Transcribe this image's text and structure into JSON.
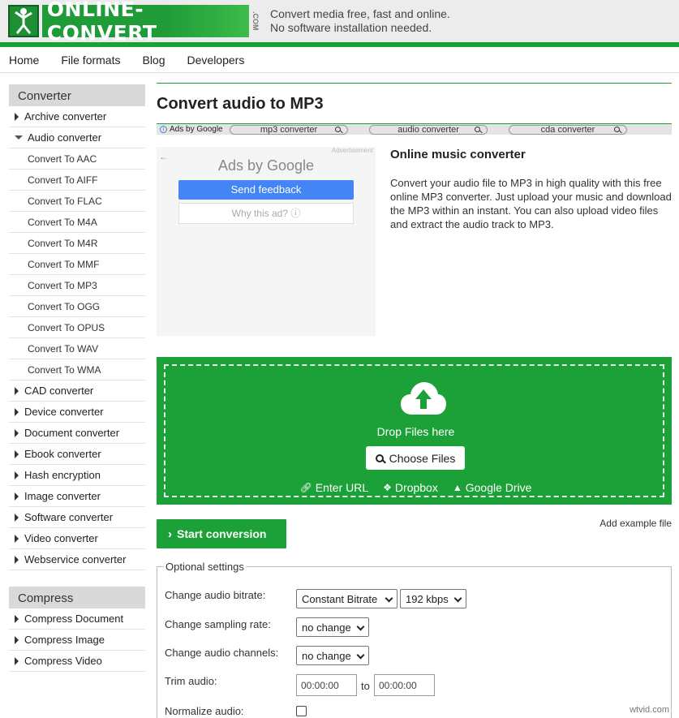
{
  "header": {
    "logo_text": "ONLINE-CONVERT",
    "logo_com": ".COM",
    "logo_icon": "figure-icon",
    "tagline_1": "Convert media free, fast and online.",
    "tagline_2": "No software installation needed.",
    "brand_color": "#1ba137"
  },
  "nav": {
    "items": [
      "Home",
      "File formats",
      "Blog",
      "Developers"
    ]
  },
  "sidebar": {
    "converter_head": "Converter",
    "converter_items": [
      "Archive converter",
      "Audio converter"
    ],
    "audio_sub": [
      "Convert To AAC",
      "Convert To AIFF",
      "Convert To FLAC",
      "Convert To M4A",
      "Convert To M4R",
      "Convert To MMF",
      "Convert To MP3",
      "Convert To OGG",
      "Convert To OPUS",
      "Convert To WAV",
      "Convert To WMA"
    ],
    "converter_items_after": [
      "CAD converter",
      "Device converter",
      "Document converter",
      "Ebook converter",
      "Hash encryption",
      "Image converter",
      "Software converter",
      "Video converter",
      "Webservice converter"
    ],
    "compress_head": "Compress",
    "compress_items": [
      "Compress Document",
      "Compress Image",
      "Compress Video"
    ]
  },
  "main": {
    "title": "Convert audio to MP3",
    "adbar": {
      "ads_by": "Ads by Google",
      "pills": [
        "mp3 converter",
        "audio converter",
        "cda converter"
      ]
    },
    "ad": {
      "label": "Advertisement",
      "back": "←",
      "ads_by": "Ads by",
      "google": "Google",
      "feedback": "Send feedback",
      "why": "Why this ad? ⓘ"
    },
    "info": {
      "heading": "Online music converter",
      "body": "Convert your audio file to MP3 in high quality with this free online MP3 converter. Just upload your music and download the MP3 within an instant. You can also upload video files and extract the audio track to MP3."
    },
    "drop": {
      "label": "Drop Files here",
      "choose": "Choose Files",
      "url": "Enter URL",
      "dropbox": "Dropbox",
      "gdrive": "Google Drive"
    },
    "start": "Start conversion",
    "example": "Add example file",
    "optional": {
      "legend": "Optional settings",
      "bitrate_label": "Change audio bitrate:",
      "bitrate_mode": "Constant Bitrate",
      "bitrate_value": "192 kbps",
      "sampling_label": "Change sampling rate:",
      "sampling_value": "no change",
      "channels_label": "Change audio channels:",
      "channels_value": "no change",
      "trim_label": "Trim audio:",
      "trim_from": "00:00:00",
      "trim_to_word": "to",
      "trim_to": "00:00:00",
      "normalize_label": "Normalize audio:"
    }
  },
  "watermark": "wtvid.com"
}
